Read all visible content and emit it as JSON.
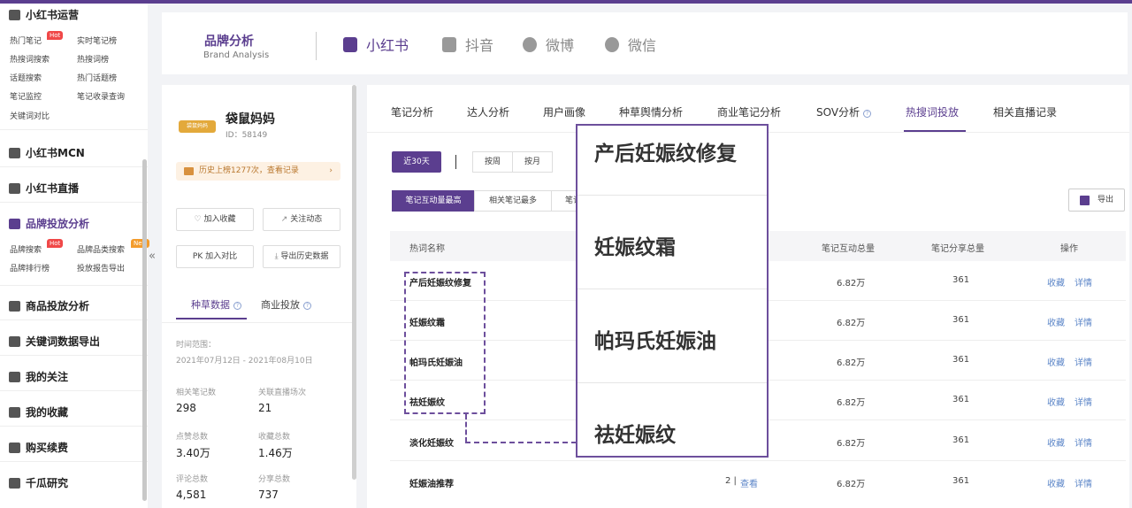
{
  "sidebar": {
    "sections": [
      {
        "label": "小红书运营",
        "items": [
          {
            "label": "热门笔记",
            "badge": "Hot"
          },
          {
            "label": "实时笔记榜"
          },
          {
            "label": "热搜词搜索"
          },
          {
            "label": "热搜词榜"
          },
          {
            "label": "话题搜索"
          },
          {
            "label": "热门话题榜"
          },
          {
            "label": "笔记监控"
          },
          {
            "label": "笔记收录查询"
          },
          {
            "label": "关键词对比"
          }
        ]
      },
      {
        "label": "小红书MCN"
      },
      {
        "label": "小红书直播"
      },
      {
        "label": "品牌投放分析",
        "items": [
          {
            "label": "品牌搜索",
            "badge": "Hot"
          },
          {
            "label": "品牌品类搜索",
            "badge": "New"
          },
          {
            "label": "品牌排行榜"
          },
          {
            "label": "投放报告导出"
          }
        ]
      },
      {
        "label": "商品投放分析"
      },
      {
        "label": "关键词数据导出"
      },
      {
        "label": "我的关注"
      },
      {
        "label": "我的收藏"
      },
      {
        "label": "购买续费"
      },
      {
        "label": "千瓜研究"
      }
    ],
    "collapse_glyph": "«"
  },
  "header": {
    "title": "品牌分析",
    "subtitle": "Brand Analysis",
    "platforms": [
      {
        "label": "小红书",
        "icon": "xiaohongshu-icon",
        "active": true
      },
      {
        "label": "抖音",
        "icon": "douyin-icon"
      },
      {
        "label": "微博",
        "icon": "weibo-icon"
      },
      {
        "label": "微信",
        "icon": "wechat-icon"
      }
    ]
  },
  "brand": {
    "logo_text": "袋鼠妈妈",
    "name": "袋鼠妈妈",
    "id": "ID：58149",
    "history": "历史上榜1277次，查看记录",
    "history_arrow": "›",
    "buttons": [
      "加入收藏",
      "关注动态",
      "PK  加入对比",
      "导出历史数据"
    ],
    "tabs": [
      "种草数据",
      "商业投放"
    ],
    "help": "?",
    "time_label": "时间范围：",
    "time_range": "2021年07月12日 - 2021年08月10日",
    "stats": [
      {
        "label": "相关笔记数",
        "value": "298"
      },
      {
        "label": "关联直播场次",
        "value": "21"
      },
      {
        "label": "点赞总数",
        "value": "3.40万"
      },
      {
        "label": "收藏总数",
        "value": "1.46万"
      },
      {
        "label": "评论总数",
        "value": "4,581"
      },
      {
        "label": "分享总数",
        "value": "737"
      }
    ]
  },
  "main": {
    "tabs": [
      "笔记分析",
      "达人分析",
      "用户画像",
      "种草舆情分析",
      "商业笔记分析",
      "SOV分析",
      "热搜词投放",
      "相关直播记录"
    ],
    "active_tab": "热搜词投放",
    "period_buttons": [
      "近30天",
      "按周",
      "按月"
    ],
    "sort_buttons": [
      "笔记互动量最高",
      "相关笔记最多",
      "笔记"
    ],
    "export_label": "导出",
    "columns": [
      "热词名称",
      "笔记互动总量",
      "笔记分享总量",
      "操作"
    ],
    "rows": [
      {
        "keyword": "产后妊娠纹修复",
        "interact": "6.82万",
        "share": "361",
        "actions": [
          "收藏",
          "详情"
        ]
      },
      {
        "keyword": "妊娠纹霜",
        "interact": "6.82万",
        "share": "361",
        "actions": [
          "收藏",
          "详情"
        ]
      },
      {
        "keyword": "帕玛氏妊娠油",
        "interact": "6.82万",
        "share": "361",
        "actions": [
          "收藏",
          "详情"
        ]
      },
      {
        "keyword": "祛妊娠纹",
        "interact": "6.82万",
        "share": "361",
        "actions": [
          "收藏",
          "详情"
        ]
      },
      {
        "keyword": "淡化妊娠纹",
        "interact": "6.82万",
        "share": "361",
        "actions": [
          "收藏",
          "详情"
        ]
      },
      {
        "keyword": "妊娠油推荐",
        "notes": "2 | ",
        "view": "查看",
        "interact": "6.82万",
        "share": "361",
        "actions": [
          "收藏",
          "详情"
        ]
      }
    ]
  },
  "zoom": {
    "items": [
      "产后妊娠纹修复",
      "妊娠纹霜",
      "帕玛氏妊娠油",
      "祛妊娠纹"
    ]
  },
  "colors": {
    "accent": "#5b3e8f",
    "link": "#5c86c8",
    "hot": "#f04848",
    "new": "#f39c2c"
  }
}
